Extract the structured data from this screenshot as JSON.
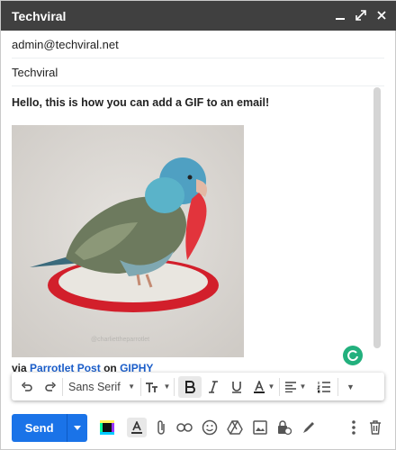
{
  "window": {
    "title": "Techviral"
  },
  "compose": {
    "to": "admin@techviral.net",
    "subject": "Techviral",
    "body_text": "Hello, this is how you can add a GIF to an email!",
    "gif_watermark": "@charliettheparrotlet",
    "via_prefix": "via",
    "via_source": "Parrotlet Post",
    "via_on": "on",
    "via_platform": "GIPHY"
  },
  "format_bar": {
    "font": "Sans Serif"
  },
  "bottom": {
    "send_label": "Send"
  },
  "icons": [
    "minimize-icon",
    "expand-icon",
    "close-icon",
    "undo-icon",
    "redo-icon",
    "text-size-icon",
    "bold-icon",
    "italic-icon",
    "underline-icon",
    "text-color-icon",
    "align-icon",
    "numbered-list-icon",
    "more-formatting-icon",
    "giphy-icon",
    "formatting-options-icon",
    "attach-icon",
    "link-icon",
    "emoji-icon",
    "drive-icon",
    "photo-icon",
    "confidential-icon",
    "signature-icon",
    "more-options-icon",
    "trash-icon",
    "grammarly-icon"
  ],
  "colors": {
    "titlebar": "#404040",
    "send": "#1a73e8",
    "link": "#1a5dc9",
    "grammarly": "#22b07d"
  }
}
